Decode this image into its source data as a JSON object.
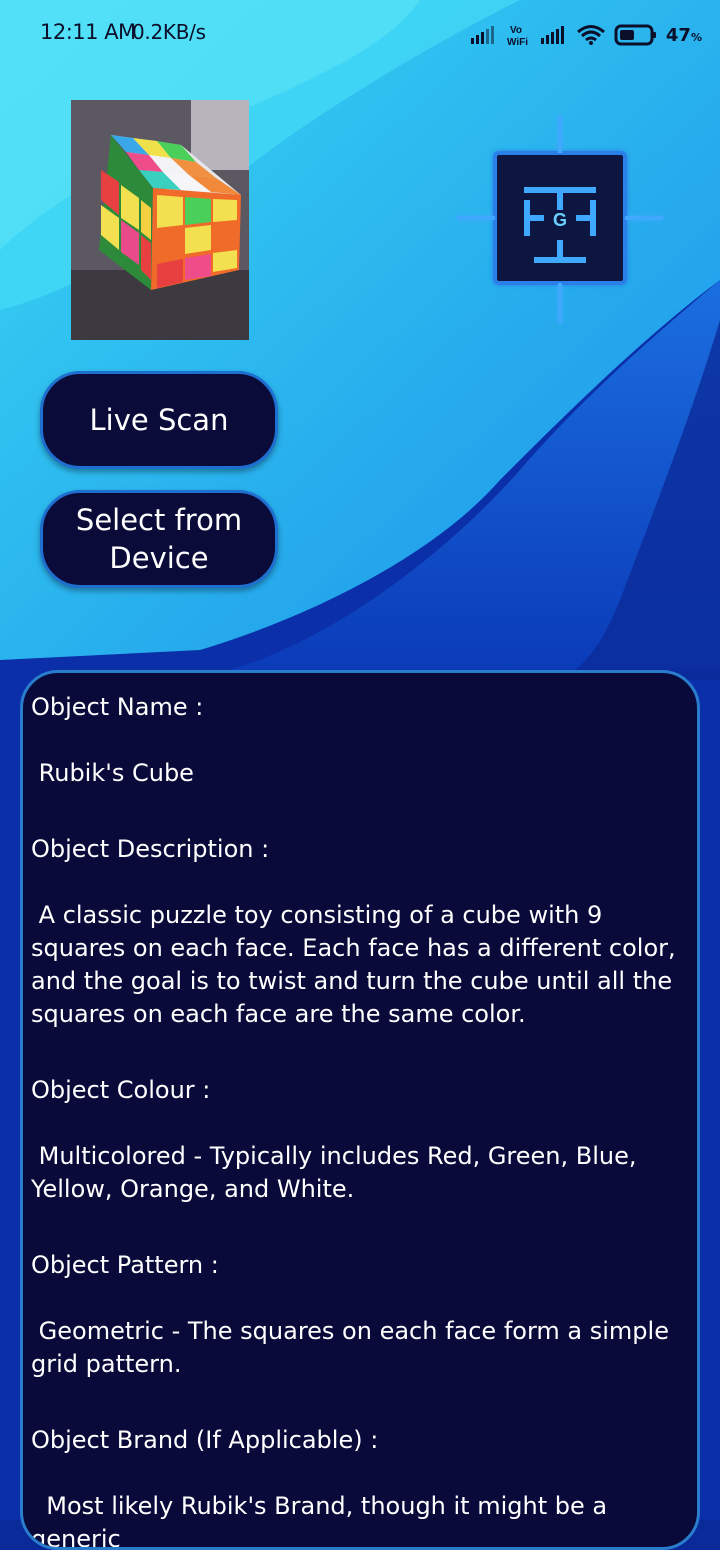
{
  "status_bar": {
    "time": "12:11 AM",
    "speed": "0.2KB/s",
    "battery": "47"
  },
  "logo": {
    "letter": "G"
  },
  "buttons": {
    "live_scan": "Live Scan",
    "select_from_device": "Select from Device"
  },
  "result": {
    "object_name_label": "Object Name :",
    "object_name_value": " Rubik's Cube",
    "object_description_label": "Object Description :",
    "object_description_value": " A classic puzzle toy consisting of a cube with 9 squares on each face. Each face has a different color, and the goal is to twist and turn the cube until all the squares on each face are the same color.",
    "object_colour_label": "Object Colour :",
    "object_colour_value": " Multicolored - Typically includes Red, Green, Blue, Yellow, Orange, and White.",
    "object_pattern_label": "Object Pattern :",
    "object_pattern_value": " Geometric - The squares on each face form a simple grid pattern.",
    "object_brand_label": "Object Brand (If Applicable) :",
    "object_brand_value": "  Most likely Rubik's Brand, though it might be a generic"
  },
  "colors": {
    "panel_bg": "#09093a",
    "panel_border": "#2a7ccc",
    "button_bg": "#0b0b3a",
    "accent": "#1e6fd0"
  }
}
